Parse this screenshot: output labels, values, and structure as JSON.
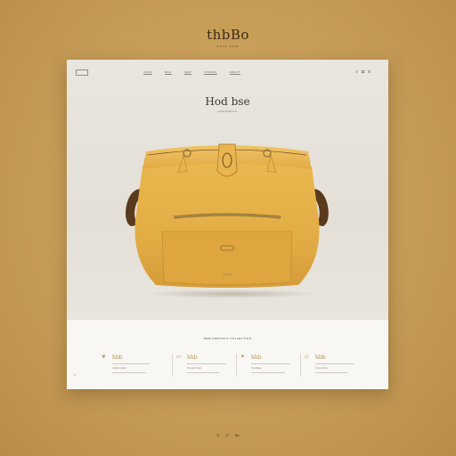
{
  "brand": {
    "name": "thbBo",
    "tagline": "ESTD 1998"
  },
  "nav": {
    "items": [
      "SHOP",
      "BAG",
      "NEW",
      "STORES",
      "ABOUT"
    ],
    "icons": [
      "search-icon",
      "bag-icon",
      "menu-icon"
    ]
  },
  "hero": {
    "title": "Hod bse",
    "subtitle": "HANDBAGS",
    "product_tag": "LEATHER"
  },
  "footer": {
    "heading": "NEW ARRIVALS COLLECTION",
    "columns": [
      {
        "title": "hbb",
        "text": "Leather goods"
      },
      {
        "title": "hhb",
        "text": "Shoulder bags"
      },
      {
        "title": "hhb",
        "text": "Handbags"
      },
      {
        "title": "hbb",
        "text": "Accessories"
      }
    ],
    "copyright": "©"
  },
  "bottom": {
    "links": [
      "D",
      "O",
      "Bs"
    ]
  },
  "colors": {
    "background": "#c69d57",
    "card": "#f3f1ec",
    "bag": "#e5b04a",
    "accent": "#b0904f"
  }
}
